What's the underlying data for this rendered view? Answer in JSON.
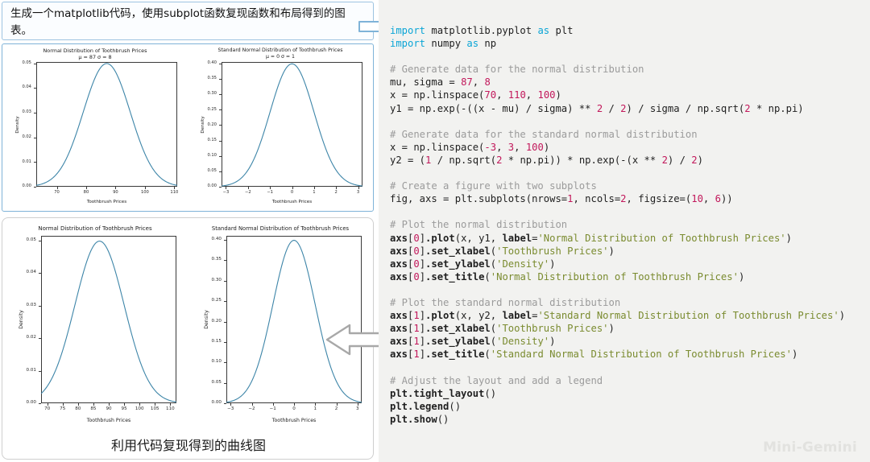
{
  "prompt": {
    "text": "生成一个matplotlib代码，使用subplot函数复现函数和布局得到的图表。"
  },
  "caption": "利用代码复现得到的曲线图",
  "watermark": "Mini-Gemini",
  "icons": {
    "arrow_right": "arrow-right-icon",
    "arrow_left": "arrow-left-icon"
  },
  "colors": {
    "curve": "#3d85a8",
    "prompt_border": "#9dc3e0",
    "original_border": "#7fb3d8",
    "repro_border": "#cfcfcf",
    "code_bg": "#f2f2f0",
    "keyword": "#0aa5d6",
    "comment": "#9b9b9b",
    "number": "#c2185b",
    "string": "#7a8b2f"
  },
  "chart_data": [
    {
      "panel": "original-left",
      "type": "line",
      "title": "Normal Distribution of Toothbrush Prices",
      "subtitle": "μ = 87 σ = 8",
      "xlabel": "Toothbrush Prices",
      "ylabel": "Density",
      "xlim": [
        63,
        111
      ],
      "ylim": [
        0.0,
        0.0505
      ],
      "xticks": [
        70,
        80,
        90,
        100,
        110
      ],
      "xticklabels": [
        "70",
        "80",
        "90",
        "100",
        "110"
      ],
      "yticks": [
        0.0,
        0.01,
        0.02,
        0.03,
        0.04,
        0.05
      ],
      "yticklabels": [
        "0.00",
        "0.01",
        "0.02",
        "0.03",
        "0.04",
        "0.05"
      ],
      "grid": false,
      "legend": "none",
      "series": [
        {
          "name": "Normal Distribution of Toothbrush Prices",
          "mu": 87,
          "sigma": 8,
          "peak_y": 0.04986,
          "peak_x": 87,
          "x": [
            63,
            67,
            71,
            75,
            79,
            83,
            87,
            91,
            95,
            99,
            103,
            107,
            111
          ],
          "values": [
            0.00066,
            0.00281,
            0.00875,
            0.02177,
            0.03705,
            0.04577,
            0.04986,
            0.04577,
            0.03705,
            0.02177,
            0.00875,
            0.00281,
            0.00066
          ]
        }
      ]
    },
    {
      "panel": "original-right",
      "type": "line",
      "title": "Standard Normal Distribution of Toothbrush Prices",
      "subtitle": "μ = 0 σ = 1",
      "xlabel": "Toothbrush Prices",
      "ylabel": "Density",
      "xlim": [
        -3.2,
        3.2
      ],
      "ylim": [
        0.0,
        0.405
      ],
      "xticks": [
        -3,
        -2,
        -1,
        0,
        1,
        2,
        3
      ],
      "xticklabels": [
        "−3",
        "−2",
        "−1",
        "0",
        "1",
        "2",
        "3"
      ],
      "yticks": [
        0.0,
        0.05,
        0.1,
        0.15,
        0.2,
        0.25,
        0.3,
        0.35,
        0.4
      ],
      "yticklabels": [
        "0.00",
        "0.05",
        "0.10",
        "0.15",
        "0.20",
        "0.25",
        "0.30",
        "0.35",
        "0.40"
      ],
      "grid": false,
      "legend": "none",
      "series": [
        {
          "name": "Standard Normal Distribution of Toothbrush Prices",
          "mu": 0,
          "sigma": 1,
          "peak_y": 0.39894,
          "peak_x": 0,
          "x": [
            -3,
            -2.5,
            -2,
            -1.5,
            -1,
            -0.5,
            0,
            0.5,
            1,
            1.5,
            2,
            2.5,
            3
          ],
          "values": [
            0.00443,
            0.01753,
            0.05399,
            0.12952,
            0.24197,
            0.35207,
            0.39894,
            0.35207,
            0.24197,
            0.12952,
            0.05399,
            0.01753,
            0.00443
          ]
        }
      ]
    },
    {
      "panel": "reproduced-left",
      "type": "line",
      "title": "Normal Distribution of Toothbrush Prices",
      "subtitle": "",
      "xlabel": "Toothbrush Prices",
      "ylabel": "Density",
      "xlim": [
        68,
        112
      ],
      "ylim": [
        0.0,
        0.0515
      ],
      "xticks": [
        70,
        75,
        80,
        85,
        90,
        95,
        100,
        105,
        110
      ],
      "xticklabels": [
        "70",
        "75",
        "80",
        "85",
        "90",
        "95",
        "100",
        "105",
        "110"
      ],
      "yticks": [
        0.0,
        0.01,
        0.02,
        0.03,
        0.04,
        0.05
      ],
      "yticklabels": [
        "0.00",
        "0.01",
        "0.02",
        "0.03",
        "0.04",
        "0.05"
      ],
      "grid": false,
      "legend": "none",
      "series": [
        {
          "name": "Normal Distribution of Toothbrush Prices",
          "mu": 87,
          "sigma": 8,
          "peak_y": 0.04986,
          "peak_x": 87,
          "x": [
            70,
            75,
            80,
            85,
            90,
            95,
            100,
            105,
            110
          ],
          "values": [
            0.00519,
            0.01601,
            0.03247,
            0.04596,
            0.04596,
            0.03247,
            0.01601,
            0.00519,
            0.0011
          ]
        }
      ]
    },
    {
      "panel": "reproduced-right",
      "type": "line",
      "title": "Standard Normal Distribution of Toothbrush Prices",
      "subtitle": "",
      "xlabel": "Toothbrush Prices",
      "ylabel": "Density",
      "xlim": [
        -3.2,
        3.2
      ],
      "ylim": [
        0.0,
        0.41
      ],
      "xticks": [
        -3,
        -2,
        -1,
        0,
        1,
        2,
        3
      ],
      "xticklabels": [
        "−3",
        "−2",
        "−1",
        "0",
        "1",
        "2",
        "3"
      ],
      "yticks": [
        0.0,
        0.05,
        0.1,
        0.15,
        0.2,
        0.25,
        0.3,
        0.35,
        0.4
      ],
      "yticklabels": [
        "0.00",
        "0.05",
        "0.10",
        "0.15",
        "0.20",
        "0.25",
        "0.30",
        "0.35",
        "0.40"
      ],
      "grid": false,
      "legend": "none",
      "series": [
        {
          "name": "Standard Normal Distribution of Toothbrush Prices",
          "mu": 0,
          "sigma": 1,
          "peak_y": 0.39894,
          "peak_x": 0,
          "x": [
            -3,
            -2.5,
            -2,
            -1.5,
            -1,
            -0.5,
            0,
            0.5,
            1,
            1.5,
            2,
            2.5,
            3
          ],
          "values": [
            0.00443,
            0.01753,
            0.05399,
            0.12952,
            0.24197,
            0.35207,
            0.39894,
            0.35207,
            0.24197,
            0.12952,
            0.05399,
            0.01753,
            0.00443
          ]
        }
      ]
    }
  ],
  "code": {
    "lines": [
      [
        {
          "t": "import",
          "c": "k"
        },
        {
          "t": " matplotlib.pyplot "
        },
        {
          "t": "as",
          "c": "k"
        },
        {
          "t": " plt"
        }
      ],
      [
        {
          "t": "import",
          "c": "k"
        },
        {
          "t": " numpy "
        },
        {
          "t": "as",
          "c": "k"
        },
        {
          "t": " np"
        }
      ],
      [],
      [
        {
          "t": "# Generate data for the normal distribution",
          "c": "cm"
        }
      ],
      [
        {
          "t": "mu, sigma = "
        },
        {
          "t": "87",
          "c": "n"
        },
        {
          "t": ", "
        },
        {
          "t": "8",
          "c": "n"
        }
      ],
      [
        {
          "t": "x = np.linspace("
        },
        {
          "t": "70",
          "c": "n"
        },
        {
          "t": ", "
        },
        {
          "t": "110",
          "c": "n"
        },
        {
          "t": ", "
        },
        {
          "t": "100",
          "c": "n"
        },
        {
          "t": ")"
        }
      ],
      [
        {
          "t": "y1 = np.exp(-((x - mu) / sigma) ** "
        },
        {
          "t": "2",
          "c": "n"
        },
        {
          "t": " / "
        },
        {
          "t": "2",
          "c": "n"
        },
        {
          "t": ") / sigma / np.sqrt("
        },
        {
          "t": "2",
          "c": "n"
        },
        {
          "t": " * np.pi)"
        }
      ],
      [],
      [
        {
          "t": "# Generate data for the standard normal distribution",
          "c": "cm"
        }
      ],
      [
        {
          "t": "x = np.linspace("
        },
        {
          "t": "-3",
          "c": "n"
        },
        {
          "t": ", "
        },
        {
          "t": "3",
          "c": "n"
        },
        {
          "t": ", "
        },
        {
          "t": "100",
          "c": "n"
        },
        {
          "t": ")"
        }
      ],
      [
        {
          "t": "y2 = ("
        },
        {
          "t": "1",
          "c": "n"
        },
        {
          "t": " / np.sqrt("
        },
        {
          "t": "2",
          "c": "n"
        },
        {
          "t": " * np.pi)) * np.exp(-(x ** "
        },
        {
          "t": "2",
          "c": "n"
        },
        {
          "t": ") / "
        },
        {
          "t": "2",
          "c": "n"
        },
        {
          "t": ")"
        }
      ],
      [],
      [
        {
          "t": "# Create a figure with two subplots",
          "c": "cm"
        }
      ],
      [
        {
          "t": "fig, axs = plt.subplots(nrows="
        },
        {
          "t": "1",
          "c": "n"
        },
        {
          "t": ", ncols="
        },
        {
          "t": "2",
          "c": "n"
        },
        {
          "t": ", figsize=("
        },
        {
          "t": "10",
          "c": "n"
        },
        {
          "t": ", "
        },
        {
          "t": "6",
          "c": "n"
        },
        {
          "t": "))"
        }
      ],
      [],
      [
        {
          "t": "# Plot the normal distribution",
          "c": "cm"
        }
      ],
      [
        {
          "t": "axs",
          "c": "b"
        },
        {
          "t": "["
        },
        {
          "t": "0",
          "c": "n"
        },
        {
          "t": "]"
        },
        {
          "t": ".plot",
          "c": "b"
        },
        {
          "t": "(x, y1, "
        },
        {
          "t": "label",
          "c": "b"
        },
        {
          "t": "="
        },
        {
          "t": "'Normal Distribution of Toothbrush Prices'",
          "c": "s"
        },
        {
          "t": ")"
        }
      ],
      [
        {
          "t": "axs",
          "c": "b"
        },
        {
          "t": "["
        },
        {
          "t": "0",
          "c": "n"
        },
        {
          "t": "]"
        },
        {
          "t": ".set_xlabel",
          "c": "b"
        },
        {
          "t": "("
        },
        {
          "t": "'Toothbrush Prices'",
          "c": "s"
        },
        {
          "t": ")"
        }
      ],
      [
        {
          "t": "axs",
          "c": "b"
        },
        {
          "t": "["
        },
        {
          "t": "0",
          "c": "n"
        },
        {
          "t": "]"
        },
        {
          "t": ".set_ylabel",
          "c": "b"
        },
        {
          "t": "("
        },
        {
          "t": "'Density'",
          "c": "s"
        },
        {
          "t": ")"
        }
      ],
      [
        {
          "t": "axs",
          "c": "b"
        },
        {
          "t": "["
        },
        {
          "t": "0",
          "c": "n"
        },
        {
          "t": "]"
        },
        {
          "t": ".set_title",
          "c": "b"
        },
        {
          "t": "("
        },
        {
          "t": "'Normal Distribution of Toothbrush Prices'",
          "c": "s"
        },
        {
          "t": ")"
        }
      ],
      [],
      [
        {
          "t": "# Plot the standard normal distribution",
          "c": "cm"
        }
      ],
      [
        {
          "t": "axs",
          "c": "b"
        },
        {
          "t": "["
        },
        {
          "t": "1",
          "c": "n"
        },
        {
          "t": "]"
        },
        {
          "t": ".plot",
          "c": "b"
        },
        {
          "t": "(x, y2, "
        },
        {
          "t": "label",
          "c": "b"
        },
        {
          "t": "="
        },
        {
          "t": "'Standard Normal Distribution of Toothbrush Prices'",
          "c": "s"
        },
        {
          "t": ")"
        }
      ],
      [
        {
          "t": "axs",
          "c": "b"
        },
        {
          "t": "["
        },
        {
          "t": "1",
          "c": "n"
        },
        {
          "t": "]"
        },
        {
          "t": ".set_xlabel",
          "c": "b"
        },
        {
          "t": "("
        },
        {
          "t": "'Toothbrush Prices'",
          "c": "s"
        },
        {
          "t": ")"
        }
      ],
      [
        {
          "t": "axs",
          "c": "b"
        },
        {
          "t": "["
        },
        {
          "t": "1",
          "c": "n"
        },
        {
          "t": "]"
        },
        {
          "t": ".set_ylabel",
          "c": "b"
        },
        {
          "t": "("
        },
        {
          "t": "'Density'",
          "c": "s"
        },
        {
          "t": ")"
        }
      ],
      [
        {
          "t": "axs",
          "c": "b"
        },
        {
          "t": "["
        },
        {
          "t": "1",
          "c": "n"
        },
        {
          "t": "]"
        },
        {
          "t": ".set_title",
          "c": "b"
        },
        {
          "t": "("
        },
        {
          "t": "'Standard Normal Distribution of Toothbrush Prices'",
          "c": "s"
        },
        {
          "t": ")"
        }
      ],
      [],
      [
        {
          "t": "# Adjust the layout and add a legend",
          "c": "cm"
        }
      ],
      [
        {
          "t": "plt.tight_layout",
          "c": "b"
        },
        {
          "t": "()"
        }
      ],
      [
        {
          "t": "plt.legend",
          "c": "b"
        },
        {
          "t": "()"
        }
      ],
      [
        {
          "t": "plt.show",
          "c": "b"
        },
        {
          "t": "()"
        }
      ]
    ]
  }
}
